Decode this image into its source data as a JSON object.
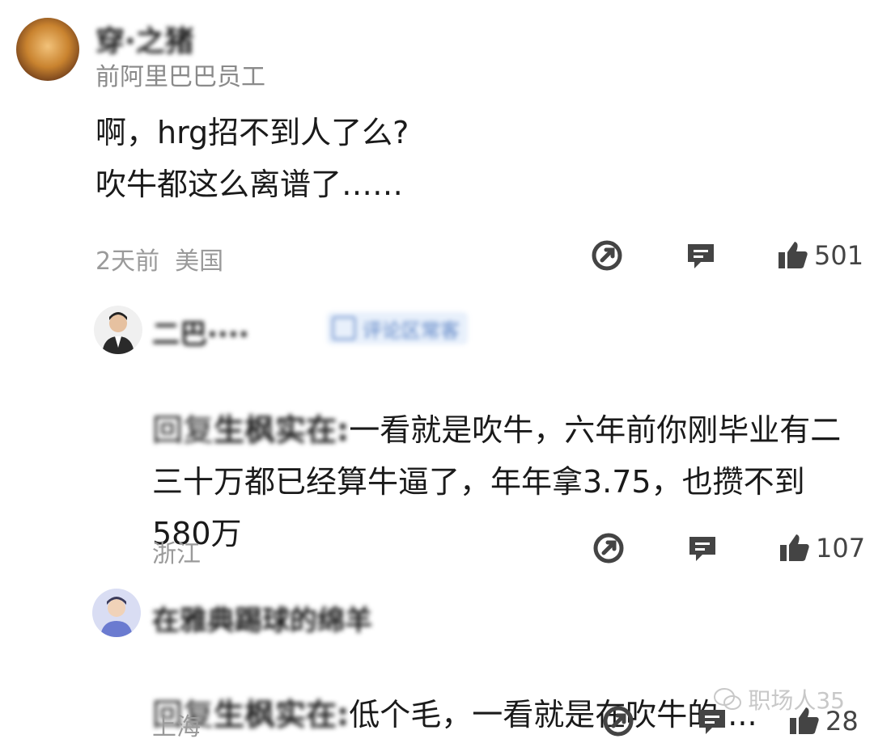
{
  "comments": [
    {
      "author": "穿·之猪",
      "author_title": "前阿里巴巴员工",
      "body": "啊，hrg招不到人了么?\n吹牛都这么离谱了……",
      "time": "2天前",
      "location": "美国",
      "likes": "501"
    },
    {
      "author": "二巴····",
      "badge_label": "评论区常客",
      "reply_prefix": "回复",
      "reply_to": "生枫实在:",
      "body": "一看就是吹牛，六年前你刚毕业有二三十万都已经算牛逼了，年年拿3.75，也攒不到580万",
      "location": "浙江",
      "likes": "107"
    },
    {
      "author": "在雅典踢球的绵羊",
      "reply_prefix": "回复",
      "reply_to": "生枫实在:",
      "body": "低个毛，一看就是在吹牛的....",
      "location": "上海",
      "likes": "28"
    }
  ],
  "watermark": "职场人35",
  "icons": {
    "share": "share-icon",
    "comment": "comment-icon",
    "like": "thumbs-up-icon"
  },
  "colors": {
    "meta_gray": "#9a9a9a",
    "icon_dark": "#444444",
    "badge_bg": "#e8f0fb"
  }
}
